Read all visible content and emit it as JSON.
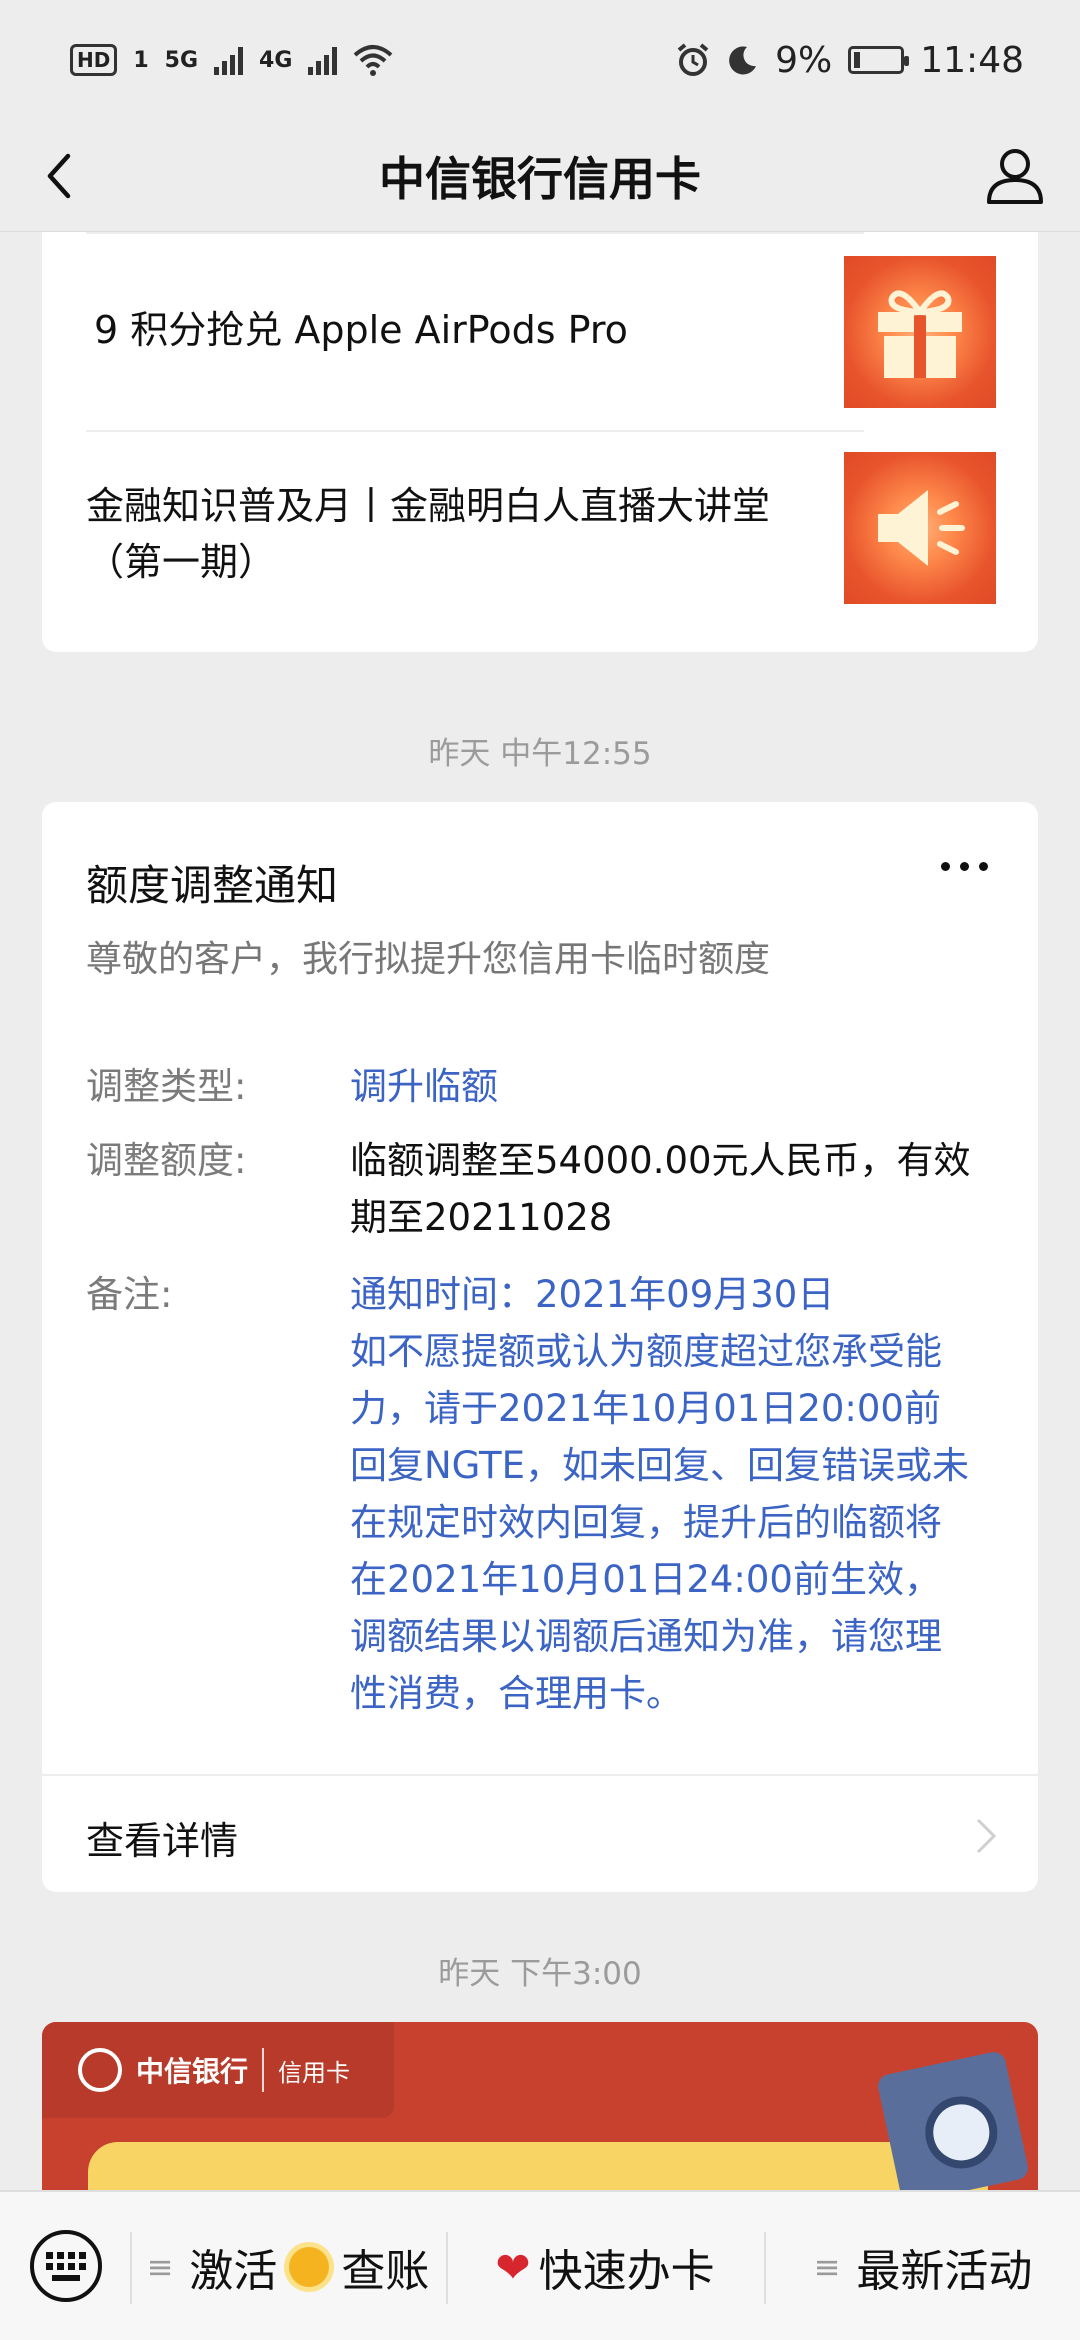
{
  "status_bar": {
    "hd": "HD",
    "sim1": "1",
    "net1": "5G",
    "net2": "4G",
    "battery": "9%",
    "time": "11:48"
  },
  "nav": {
    "title": "中信银行信用卡"
  },
  "news": {
    "items": [
      {
        "text": "9 积分抢兑 Apple AirPods Pro",
        "icon": "gift-icon"
      },
      {
        "text": "金融知识普及月丨金融明白人直播大讲堂（第一期）",
        "icon": "speaker-icon"
      }
    ]
  },
  "timestamps": [
    "昨天 中午12:55",
    "昨天 下午3:00"
  ],
  "notice": {
    "title": "额度调整通知",
    "subtitle": "尊敬的客户，我行拟提升您信用卡临时额度",
    "rows": [
      {
        "key": "调整类型:",
        "value": "调升临额"
      },
      {
        "key": "调整额度:",
        "value": "临额调整至54000.00元人民币，有效期至20211028"
      },
      {
        "key": "备注:",
        "value": "通知时间：2021年09月30日\n如不愿提额或认为额度超过您承受能力，请于2021年10月01日20:00前回复NGTE，如未回复、回复错误或未在规定时效内回复，提升后的临额将在2021年10月01日24:00前生效，调额结果以调额后通知为准，请您理性消费，合理用卡。"
      }
    ],
    "detail_label": "查看详情"
  },
  "banner": {
    "logo_cn": "中信银行",
    "logo_card": "信用卡"
  },
  "bottom_menu": {
    "item1_a": "激活",
    "item1_b": "查账",
    "item2": "快速办卡",
    "item3": "最新活动"
  },
  "colors": {
    "link_blue": "#3b64c4",
    "banner_red": "#c8412f"
  }
}
